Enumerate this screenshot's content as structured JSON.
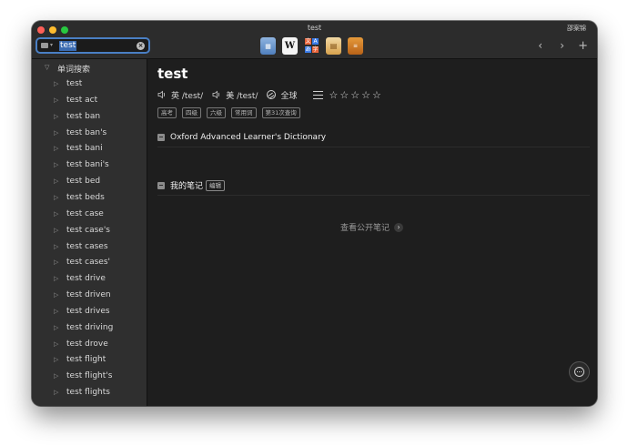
{
  "window": {
    "title": "test",
    "user": "邵案锦"
  },
  "search": {
    "value": "test",
    "placeholder": ""
  },
  "toolbar": {
    "dict_icons": [
      {
        "name": "collins-dict-icon",
        "glyph": "▦"
      },
      {
        "name": "wikipedia-icon",
        "glyph": "W"
      },
      {
        "name": "translate-icon",
        "glyph": "文A"
      },
      {
        "name": "notebook-icon",
        "glyph": "▤"
      },
      {
        "name": "book-icon",
        "glyph": "≡"
      }
    ],
    "back_glyph": "‹",
    "forward_glyph": "›",
    "add_glyph": "+"
  },
  "sidebar": {
    "group_label": "单词搜索",
    "items": [
      "test",
      "test act",
      "test ban",
      "test ban's",
      "test bani",
      "test bani's",
      "test bed",
      "test beds",
      "test case",
      "test case's",
      "test cases",
      "test cases'",
      "test drive",
      "test driven",
      "test drives",
      "test driving",
      "test drove",
      "test flight",
      "test flight's",
      "test flights"
    ]
  },
  "entry": {
    "word": "test",
    "uk_label": "英 /test/",
    "us_label": "美 /test/",
    "global_label": "全球",
    "rating": 0,
    "star_glyphs": [
      "☆",
      "☆",
      "☆",
      "☆",
      "☆"
    ],
    "tags": [
      "高考",
      "四级",
      "六级",
      "常用词",
      "第31次查询"
    ],
    "dictionary_title": "Oxford Advanced Learner's Dictionary",
    "notes_title": "我的笔记",
    "edit_label": "编辑",
    "public_notes_label": "查看公开笔记",
    "public_notes_chevron": "›"
  },
  "colors": {
    "accent": "#4a7fc4",
    "background": "#1e1e1e",
    "sidebar": "#2f2f2f"
  }
}
